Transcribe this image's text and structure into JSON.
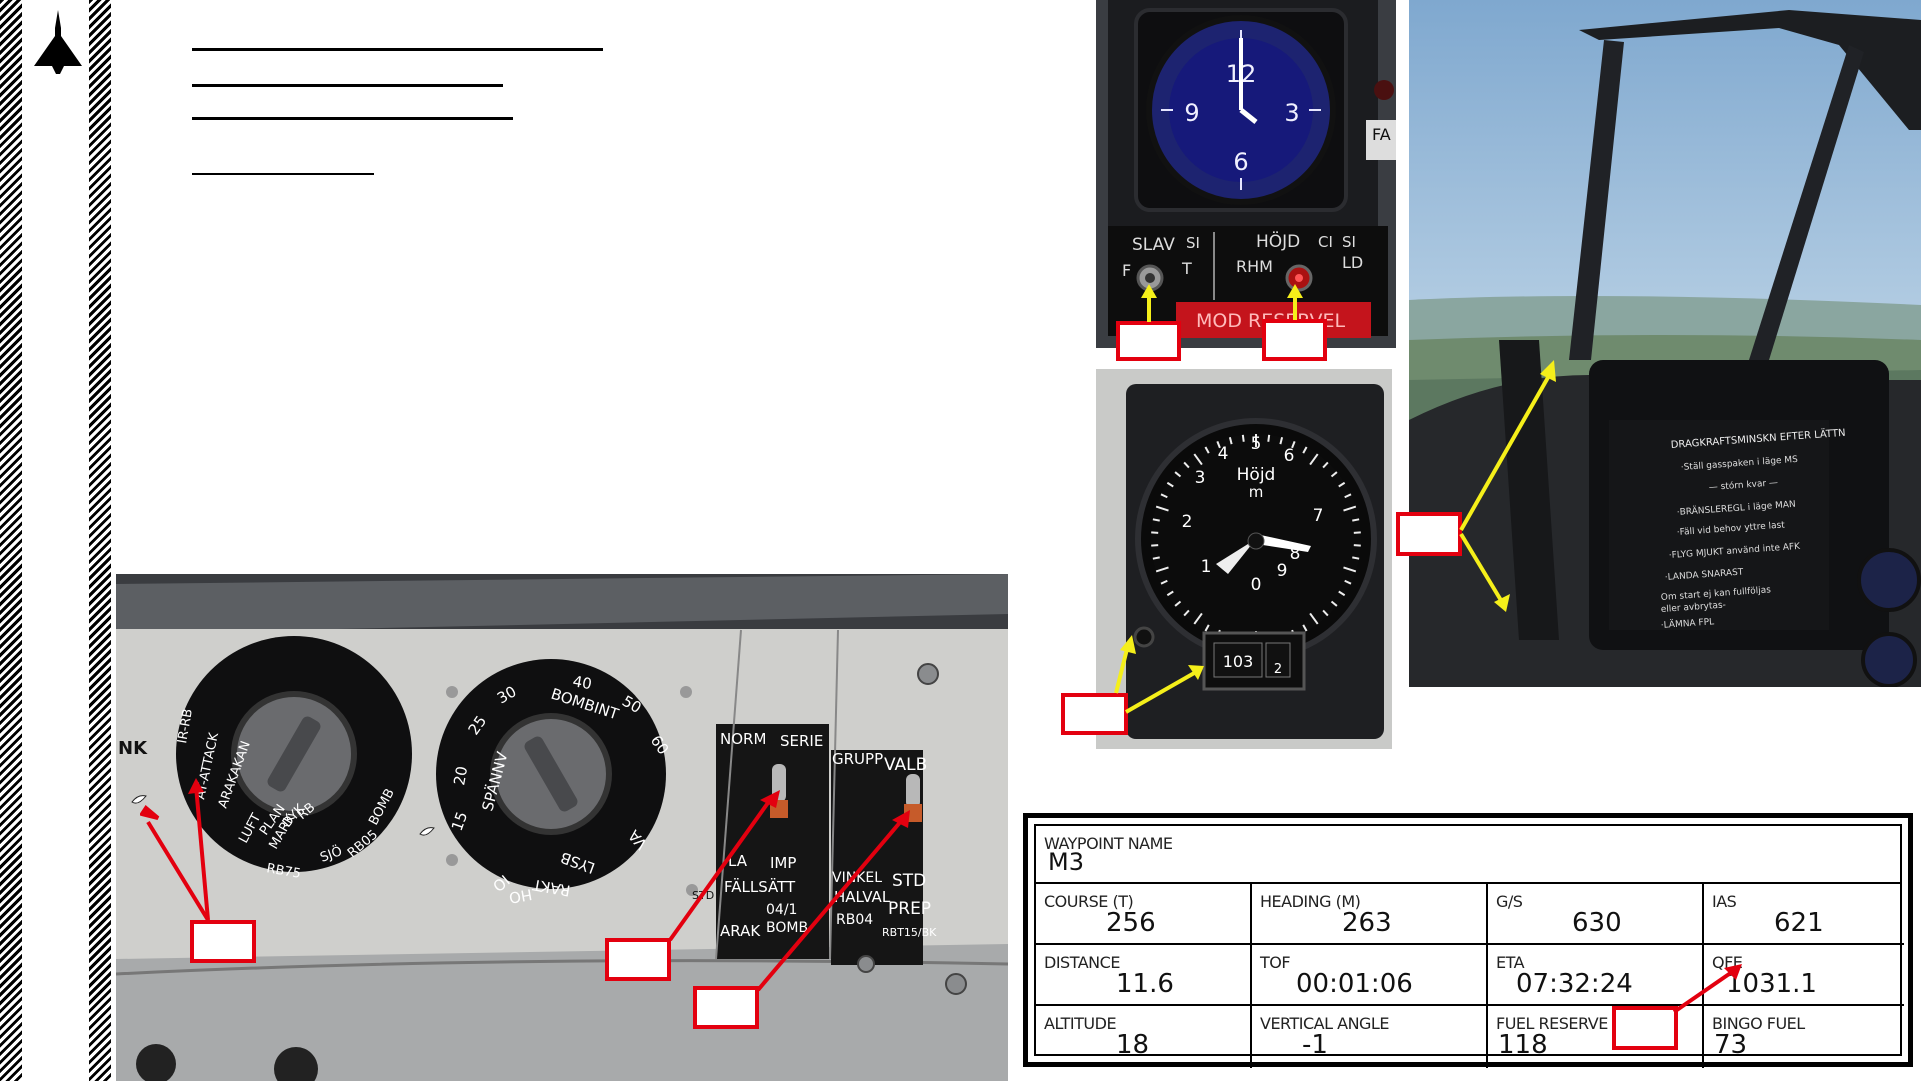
{
  "sidebar": {
    "logo_icon": "delta-wing-jet-icon"
  },
  "clock_panel": {
    "dial_numbers": [
      "12",
      "3",
      "6",
      "9"
    ],
    "label_slav": "SLAV",
    "label_si_left": "SI",
    "label_hojd": "HÖJD",
    "label_ci": "CI",
    "label_si_right": "SI",
    "label_f": "F",
    "label_t": "T",
    "label_rhm": "RHM",
    "label_ld": "LD",
    "warning_strip": "MOD  RESERVEL",
    "side_tag": "FA"
  },
  "altimeter_panel": {
    "dial_numbers": [
      "0",
      "1",
      "2",
      "3",
      "4",
      "5",
      "6",
      "7",
      "8",
      "9"
    ],
    "dial_title": "Höjd",
    "dial_unit": "m",
    "counter": "103",
    "counter_sub": "2"
  },
  "canopy_photo": {
    "placard_title": "DRAGKRAFTSMINSKN EFTER LÄTTN",
    "placard_lines": [
      "·Ställ gasspaken i läge MS",
      "— stórn kvar —",
      "·BRÄNSLEREGL i läge MAN",
      "·Fäll vid behov yttre last",
      "·FLYG MJUKT använd inte AFK",
      "·LANDA SNARAST",
      "Om start ej kan fullföljas",
      "eller avbrytas-",
      "·LÄMNA FPL"
    ]
  },
  "weapons_panel": {
    "tag_left": "NK",
    "left_dial_labels": [
      "IR-RB",
      "AT-ATTACK",
      "ARAKAKAN",
      "PLAN",
      "MARK",
      "LUFT",
      "DYK",
      "RB",
      "SJÖ",
      "BOMB",
      "RB05",
      "RB75"
    ],
    "right_dial_labels": [
      "15",
      "20",
      "25",
      "30",
      "40",
      "50",
      "60",
      "SPÄNNV",
      "BOMBINT",
      "LYSB",
      "RAKT",
      "HO",
      "VA",
      "IO"
    ],
    "label_norm": "NORM",
    "label_serie": "SERIE",
    "label_la": "LA",
    "label_imp": "IMP",
    "label_fallsatt": "FÄLLSÄTT",
    "label_0411": "04/1",
    "label_arak": "ARAK",
    "label_bomb": "BOMB",
    "label_grupp": "GRUPP",
    "label_valb": "VALB",
    "label_vinkel": "VINKEL",
    "label_halval": "HALVAL",
    "label_rb04": "RB04",
    "label_std": "STD",
    "label_prep": "PREP",
    "label_rbt": "RBT15/BK",
    "label_std_small": "STD"
  },
  "waypoint_table": {
    "waypoint_name_label": "WAYPOINT NAME",
    "waypoint_name": "M3",
    "rows": [
      [
        {
          "label": "COURSE (T)",
          "value": "256"
        },
        {
          "label": "HEADING (M)",
          "value": "263"
        },
        {
          "label": "G/S",
          "value": "630"
        },
        {
          "label": "IAS",
          "value": "621"
        }
      ],
      [
        {
          "label": "DISTANCE",
          "value": "11.6"
        },
        {
          "label": "TOF",
          "value": "00:01:06"
        },
        {
          "label": "ETA",
          "value": "07:32:24"
        },
        {
          "label": "QFE",
          "value": "1031.1"
        }
      ],
      [
        {
          "label": "ALTITUDE",
          "value": "18"
        },
        {
          "label": "VERTICAL ANGLE",
          "value": "-1"
        },
        {
          "label": "FUEL RESERVE",
          "value": "118"
        },
        {
          "label": "BINGO FUEL",
          "value": "73"
        }
      ]
    ]
  },
  "colors": {
    "callout_red": "#e3000f",
    "callout_yellow": "#f5ef1a",
    "panel_black": "#151515",
    "panel_grey": "#cfcfcc"
  }
}
